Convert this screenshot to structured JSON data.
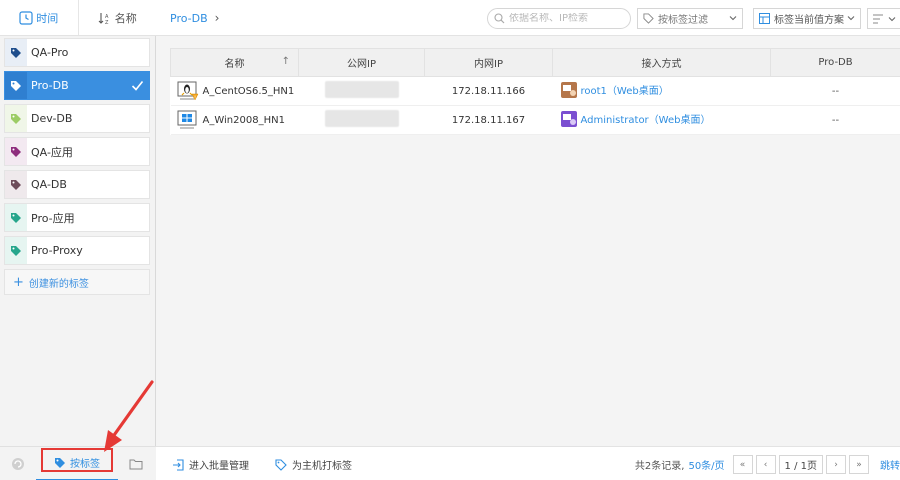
{
  "sidebar": {
    "sort_time": "时间",
    "sort_name": "名称",
    "tags": [
      {
        "label": "QA-Pro",
        "color": "#1f4e8c"
      },
      {
        "label": "Pro-DB",
        "color": "#ffffff"
      },
      {
        "label": "Dev-DB",
        "color": "#9ccc65"
      },
      {
        "label": "QA-应用",
        "color": "#8e2d7d"
      },
      {
        "label": "QA-DB",
        "color": "#6d4c5a"
      },
      {
        "label": "Pro-应用",
        "color": "#26a68c"
      },
      {
        "label": "Pro-Proxy",
        "color": "#26a68c"
      }
    ],
    "create_tag": "创建新的标签",
    "bottom_by_tag": "按标签"
  },
  "topbar": {
    "breadcrumb": "Pro-DB",
    "search_placeholder": "依据名称、IP检索",
    "filter_label": "按标签过滤",
    "scheme_label": "标签当前值方案"
  },
  "table": {
    "headers": [
      "名称",
      "公网IP",
      "内网IP",
      "接入方式",
      "Pro-DB"
    ],
    "rows": [
      {
        "name": "A_CentOS6.5_HN1",
        "os": "linux",
        "private_ip": "172.18.11.166",
        "access": "root1（Web桌面）",
        "tag_value": "--"
      },
      {
        "name": "A_Win2008_HN1",
        "os": "windows",
        "private_ip": "172.18.11.167",
        "access": "Administrator（Web桌面）",
        "tag_value": "--"
      }
    ]
  },
  "bottombar": {
    "batch_label": "进入批量管理",
    "tag_host_label": "为主机打标签",
    "total_text": "共2条记录,",
    "per_page": "50条/页",
    "page_indicator": "1 / 1页",
    "jump": "跳转"
  },
  "colors": {
    "accent": "#2f8ee0",
    "selected_tag": "#3a8fe0",
    "annotation": "#e53935"
  }
}
